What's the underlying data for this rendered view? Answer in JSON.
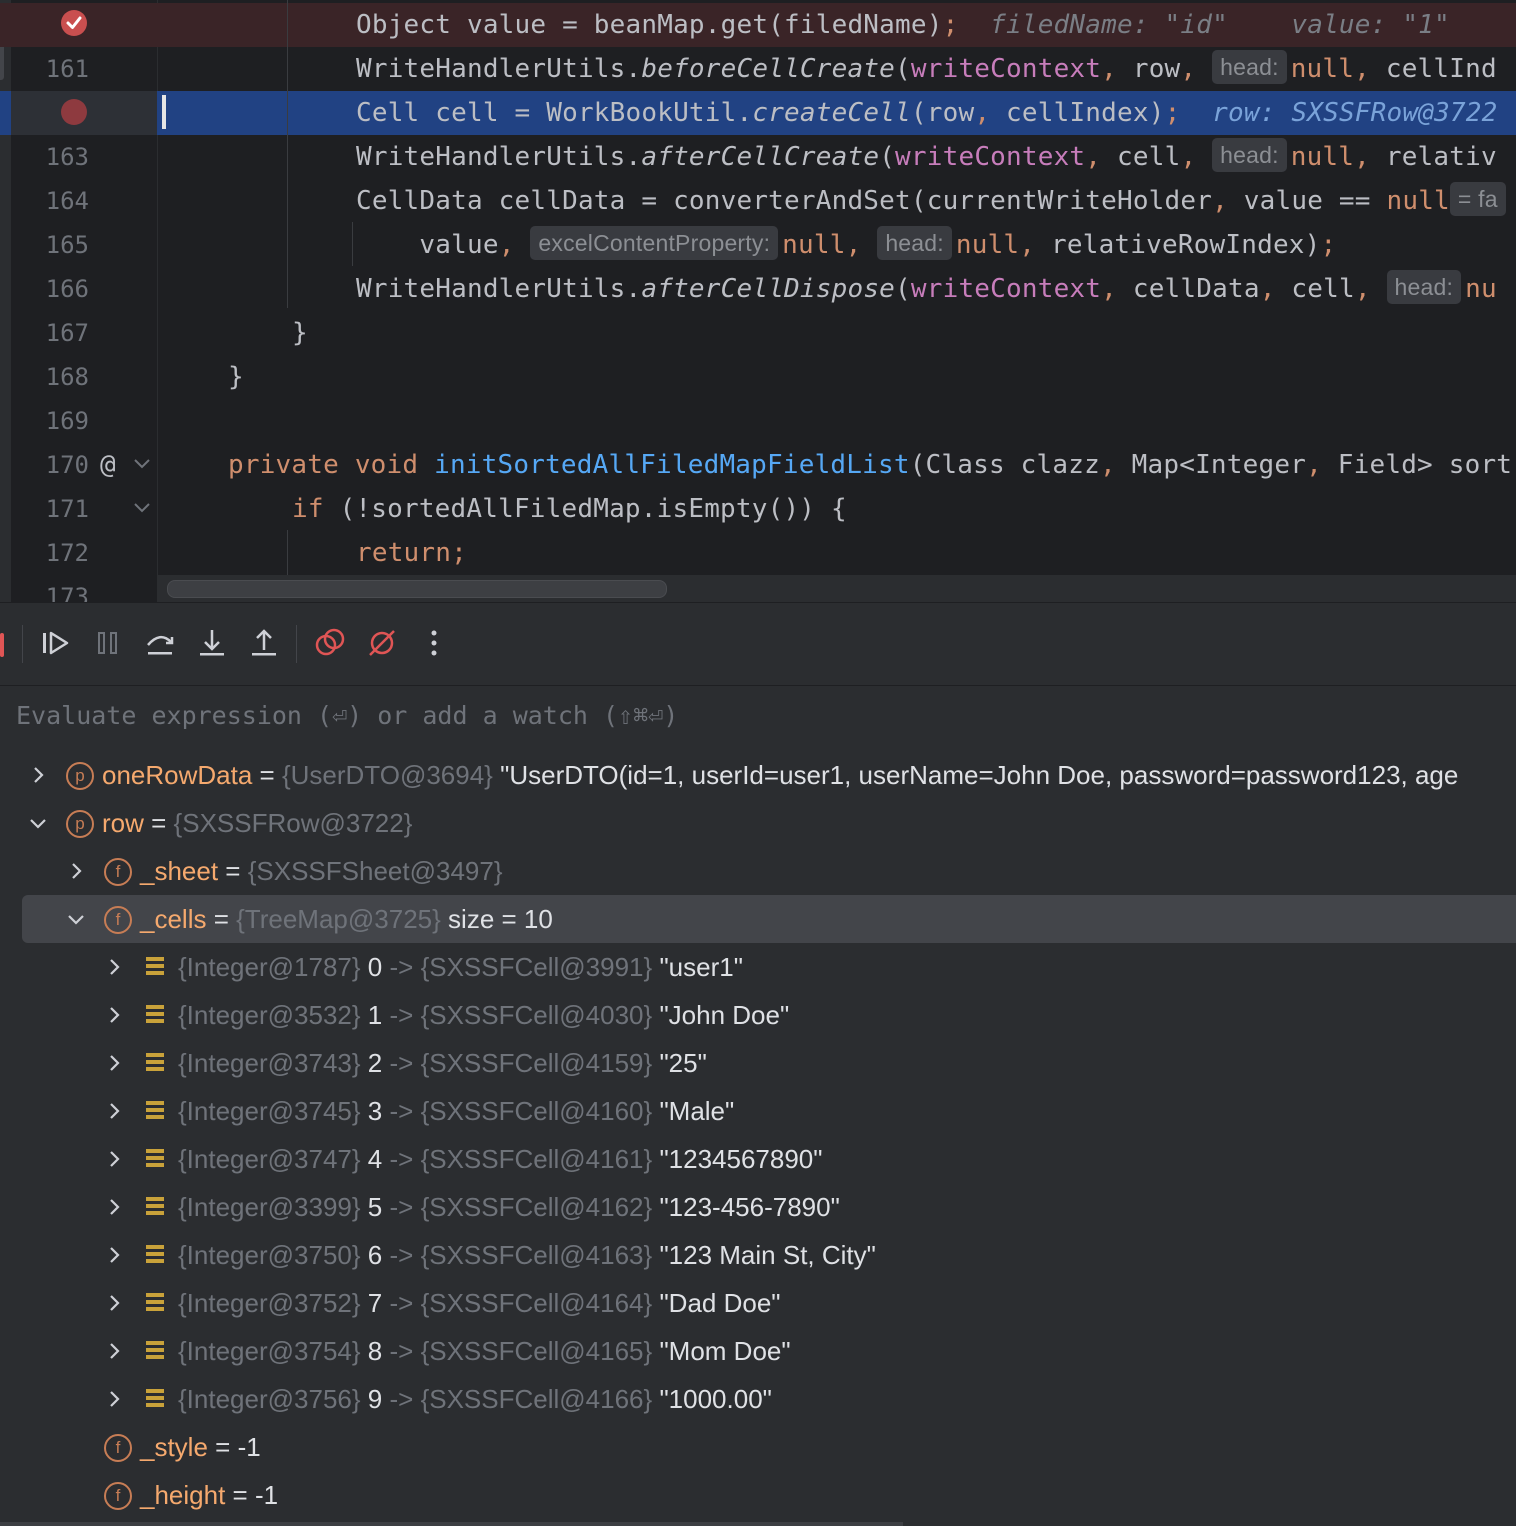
{
  "editor": {
    "lines": [
      {
        "num": "",
        "exec": true,
        "parts": [
          [
            "txt",
            "Object value = beanMap.get(filedName)"
          ],
          [
            "kw",
            ";"
          ],
          [
            "inl",
            "  filedName: \"id\"    value: \"1\""
          ]
        ]
      },
      {
        "num": "161",
        "parts": [
          [
            "txt",
            "WriteHandlerUtils."
          ],
          [
            "fnit",
            "beforeCellCreate"
          ],
          [
            "txt",
            "("
          ],
          [
            "purp",
            "writeContext"
          ],
          [
            "kw",
            ","
          ],
          [
            "txt",
            " row"
          ],
          [
            "kw",
            ","
          ],
          [
            "txt",
            " "
          ],
          [
            "hint",
            "head:"
          ],
          [
            "kw",
            "null"
          ],
          [
            "kw",
            ","
          ],
          [
            "txt",
            " cellInd"
          ]
        ]
      },
      {
        "num": "",
        "sel": true,
        "parts": [
          [
            "txt",
            "Cell cell = WorkBookUtil."
          ],
          [
            "fnit",
            "createCell"
          ],
          [
            "txt",
            "(row"
          ],
          [
            "kw",
            ","
          ],
          [
            "txt",
            " cellIndex)"
          ],
          [
            "kw",
            ";"
          ],
          [
            "inlsel",
            "  row: SXSSFRow@3722"
          ]
        ]
      },
      {
        "num": "163",
        "parts": [
          [
            "txt",
            "WriteHandlerUtils."
          ],
          [
            "fnit",
            "afterCellCreate"
          ],
          [
            "txt",
            "("
          ],
          [
            "purp",
            "writeContext"
          ],
          [
            "kw",
            ","
          ],
          [
            "txt",
            " cell"
          ],
          [
            "kw",
            ","
          ],
          [
            "txt",
            " "
          ],
          [
            "hint",
            "head:"
          ],
          [
            "kw",
            "null"
          ],
          [
            "kw",
            ","
          ],
          [
            "txt",
            " relativ"
          ]
        ]
      },
      {
        "num": "164",
        "parts": [
          [
            "txt",
            "CellData cellData = converterAndSet(currentWriteHolder"
          ],
          [
            "kw",
            ","
          ],
          [
            "txt",
            " value == "
          ],
          [
            "kw",
            "null"
          ],
          [
            "hint",
            "= fa"
          ]
        ]
      },
      {
        "num": "165",
        "parts": [
          [
            "txt",
            "    value"
          ],
          [
            "kw",
            ","
          ],
          [
            "txt",
            " "
          ],
          [
            "hint",
            "excelContentProperty:"
          ],
          [
            "kw",
            "null"
          ],
          [
            "kw",
            ","
          ],
          [
            "txt",
            " "
          ],
          [
            "hint",
            "head:"
          ],
          [
            "kw",
            "null"
          ],
          [
            "kw",
            ","
          ],
          [
            "txt",
            " relativeRowIndex)"
          ],
          [
            "kw",
            ";"
          ]
        ]
      },
      {
        "num": "166",
        "parts": [
          [
            "txt",
            "WriteHandlerUtils."
          ],
          [
            "fnit",
            "afterCellDispose"
          ],
          [
            "txt",
            "("
          ],
          [
            "purp",
            "writeContext"
          ],
          [
            "kw",
            ","
          ],
          [
            "txt",
            " cellData"
          ],
          [
            "kw",
            ","
          ],
          [
            "txt",
            " cell"
          ],
          [
            "kw",
            ","
          ],
          [
            "txt",
            " "
          ],
          [
            "hint",
            "head:"
          ],
          [
            "kw",
            "nu"
          ]
        ]
      },
      {
        "num": "167",
        "parts": [
          [
            "txt",
            "}"
          ]
        ]
      },
      {
        "num": "168",
        "parts": [
          [
            "txt",
            "}"
          ]
        ]
      },
      {
        "num": "169",
        "parts": []
      },
      {
        "num": "170",
        "parts": [
          [
            "kw",
            "private void "
          ],
          [
            "fn",
            "initSortedAllFiledMapFieldList"
          ],
          [
            "txt",
            "(Class clazz"
          ],
          [
            "kw",
            ","
          ],
          [
            "txt",
            " Map<Integer"
          ],
          [
            "kw",
            ","
          ],
          [
            "txt",
            " Field> sort"
          ]
        ]
      },
      {
        "num": "171",
        "parts": [
          [
            "kw",
            "if "
          ],
          [
            "txt",
            "(!sortedAllFiledMap.isEmpty()) {"
          ]
        ]
      },
      {
        "num": "172",
        "parts": [
          [
            "kw",
            "return;"
          ]
        ]
      },
      {
        "num": "173",
        "parts": []
      }
    ],
    "gutter_symbols": {
      "line170": "@"
    }
  },
  "evaluate": {
    "placeholder": "Evaluate expression (⏎) or add a watch (⇧⌘⏎)"
  },
  "variables": {
    "onerowdata": {
      "name": "oneRowData",
      "eq": " = ",
      "type": "{UserDTO@3694}",
      "value": " \"UserDTO(id=1, userId=user1, userName=John Doe, password=password123, age"
    },
    "row": {
      "name": "row",
      "eq": " = ",
      "type": "{SXSSFRow@3722}"
    },
    "sheet": {
      "name": "_sheet",
      "eq": " = ",
      "type": "{SXSSFSheet@3497}"
    },
    "cells": {
      "name": "_cells",
      "eq": " = ",
      "type": "{TreeMap@3725}",
      "size": "size = 10"
    },
    "entries": [
      {
        "key": "{Integer@1787}",
        "idx": "0",
        "arrow": "->",
        "cell": "{SXSSFCell@3991}",
        "val": "\"user1\""
      },
      {
        "key": "{Integer@3532}",
        "idx": "1",
        "arrow": "->",
        "cell": "{SXSSFCell@4030}",
        "val": "\"John Doe\""
      },
      {
        "key": "{Integer@3743}",
        "idx": "2",
        "arrow": "->",
        "cell": "{SXSSFCell@4159}",
        "val": "\"25\""
      },
      {
        "key": "{Integer@3745}",
        "idx": "3",
        "arrow": "->",
        "cell": "{SXSSFCell@4160}",
        "val": "\"Male\""
      },
      {
        "key": "{Integer@3747}",
        "idx": "4",
        "arrow": "->",
        "cell": "{SXSSFCell@4161}",
        "val": "\"1234567890\""
      },
      {
        "key": "{Integer@3399}",
        "idx": "5",
        "arrow": "->",
        "cell": "{SXSSFCell@4162}",
        "val": "\"123-456-7890\""
      },
      {
        "key": "{Integer@3750}",
        "idx": "6",
        "arrow": "->",
        "cell": "{SXSSFCell@4163}",
        "val": "\"123 Main St, City\""
      },
      {
        "key": "{Integer@3752}",
        "idx": "7",
        "arrow": "->",
        "cell": "{SXSSFCell@4164}",
        "val": "\"Dad Doe\""
      },
      {
        "key": "{Integer@3754}",
        "idx": "8",
        "arrow": "->",
        "cell": "{SXSSFCell@4165}",
        "val": "\"Mom Doe\""
      },
      {
        "key": "{Integer@3756}",
        "idx": "9",
        "arrow": "->",
        "cell": "{SXSSFCell@4166}",
        "val": "\"1000.00\""
      }
    ],
    "style": {
      "name": "_style",
      "eq": " = ",
      "value": "-1"
    },
    "height": {
      "name": "_height",
      "eq": " = ",
      "value": "-1"
    },
    "badges": {
      "property": "p",
      "field": "f"
    }
  },
  "colors": {
    "background": "#1e1f22",
    "panel": "#2b2d30",
    "keyword": "#cf8e6d",
    "method": "#56a8f5",
    "param": "#c77dbb",
    "breakpoint": "#c94f4f",
    "selection": "#214283",
    "var_name": "#f5a96e"
  }
}
